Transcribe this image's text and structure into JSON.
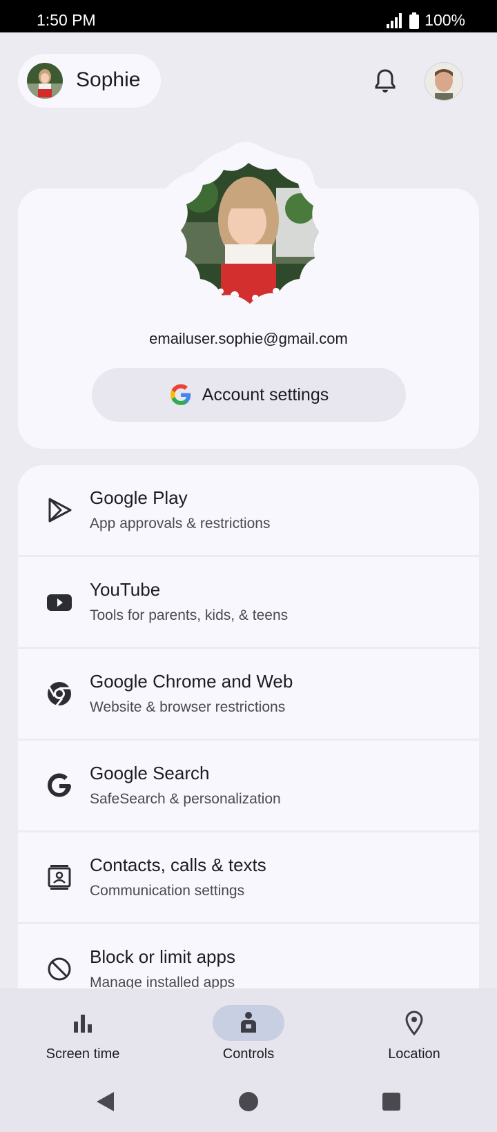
{
  "status": {
    "time": "1:50 PM",
    "battery": "100%"
  },
  "header": {
    "child_name": "Sophie"
  },
  "profile": {
    "email": "emailuser.sophie@gmail.com",
    "account_button": "Account settings"
  },
  "items": [
    {
      "title": "Google Play",
      "subtitle": "App approvals & restrictions",
      "icon": "play-icon"
    },
    {
      "title": "YouTube",
      "subtitle": "Tools for parents, kids, & teens",
      "icon": "youtube-icon"
    },
    {
      "title": "Google Chrome and Web",
      "subtitle": "Website & browser restrictions",
      "icon": "chrome-icon"
    },
    {
      "title": "Google Search",
      "subtitle": "SafeSearch & personalization",
      "icon": "google-g-icon"
    },
    {
      "title": "Contacts, calls & texts",
      "subtitle": "Communication settings",
      "icon": "contact-card-icon"
    },
    {
      "title": "Block or limit apps",
      "subtitle": "Manage installed apps",
      "icon": "block-icon"
    }
  ],
  "nav": [
    {
      "label": "Screen time",
      "icon": "bar-chart-icon"
    },
    {
      "label": "Controls",
      "icon": "person-lock-icon",
      "selected": true
    },
    {
      "label": "Location",
      "icon": "location-pin-icon"
    }
  ],
  "colors": {
    "background": "#ecebf2",
    "card": "#f8f7fd",
    "selected_pill": "#c9cfe2"
  }
}
